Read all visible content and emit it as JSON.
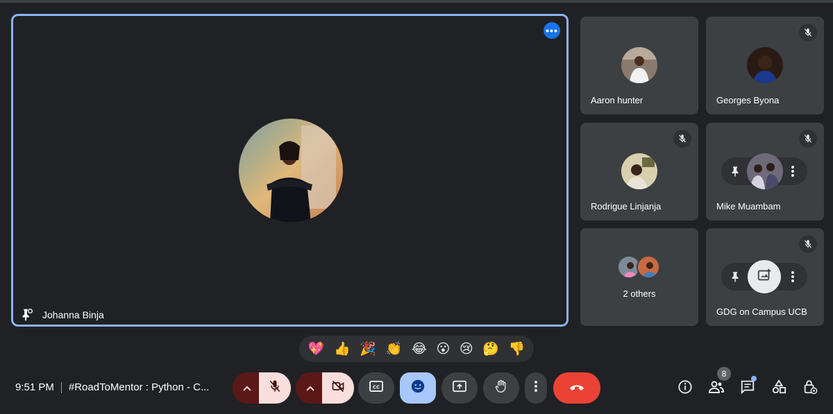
{
  "main_speaker": {
    "name": "Johanna Binja"
  },
  "participants": [
    {
      "name": "Aaron hunter",
      "muted": false
    },
    {
      "name": "Georges Byona",
      "muted": true
    },
    {
      "name": "Rodrigue Linjanja",
      "muted": true
    },
    {
      "name": "Mike Muambam",
      "muted": true
    },
    {
      "others_label": "2 others"
    },
    {
      "name": "GDG on Campus UCB",
      "muted": true
    }
  ],
  "reactions": [
    "💖",
    "👍",
    "🎉",
    "👏",
    "😂",
    "😮",
    "😢",
    "🤔",
    "👎"
  ],
  "meeting": {
    "time": "9:51 PM",
    "title": "#RoadToMentor : Python - C..."
  },
  "people_count": "8",
  "colors": {
    "accent": "#8ab4f8",
    "end_call": "#ea4335",
    "mic_off_bg": "#f9dedc",
    "emoji_btn": "#a8c7fa"
  },
  "icons": [
    "mic-off-icon",
    "camera-off-icon",
    "captions-icon",
    "emoji-icon",
    "present-icon",
    "raise-hand-icon",
    "more-vert-icon",
    "end-call-icon",
    "info-icon",
    "people-icon",
    "chat-icon",
    "activities-icon",
    "host-controls-icon",
    "pin-icon"
  ]
}
